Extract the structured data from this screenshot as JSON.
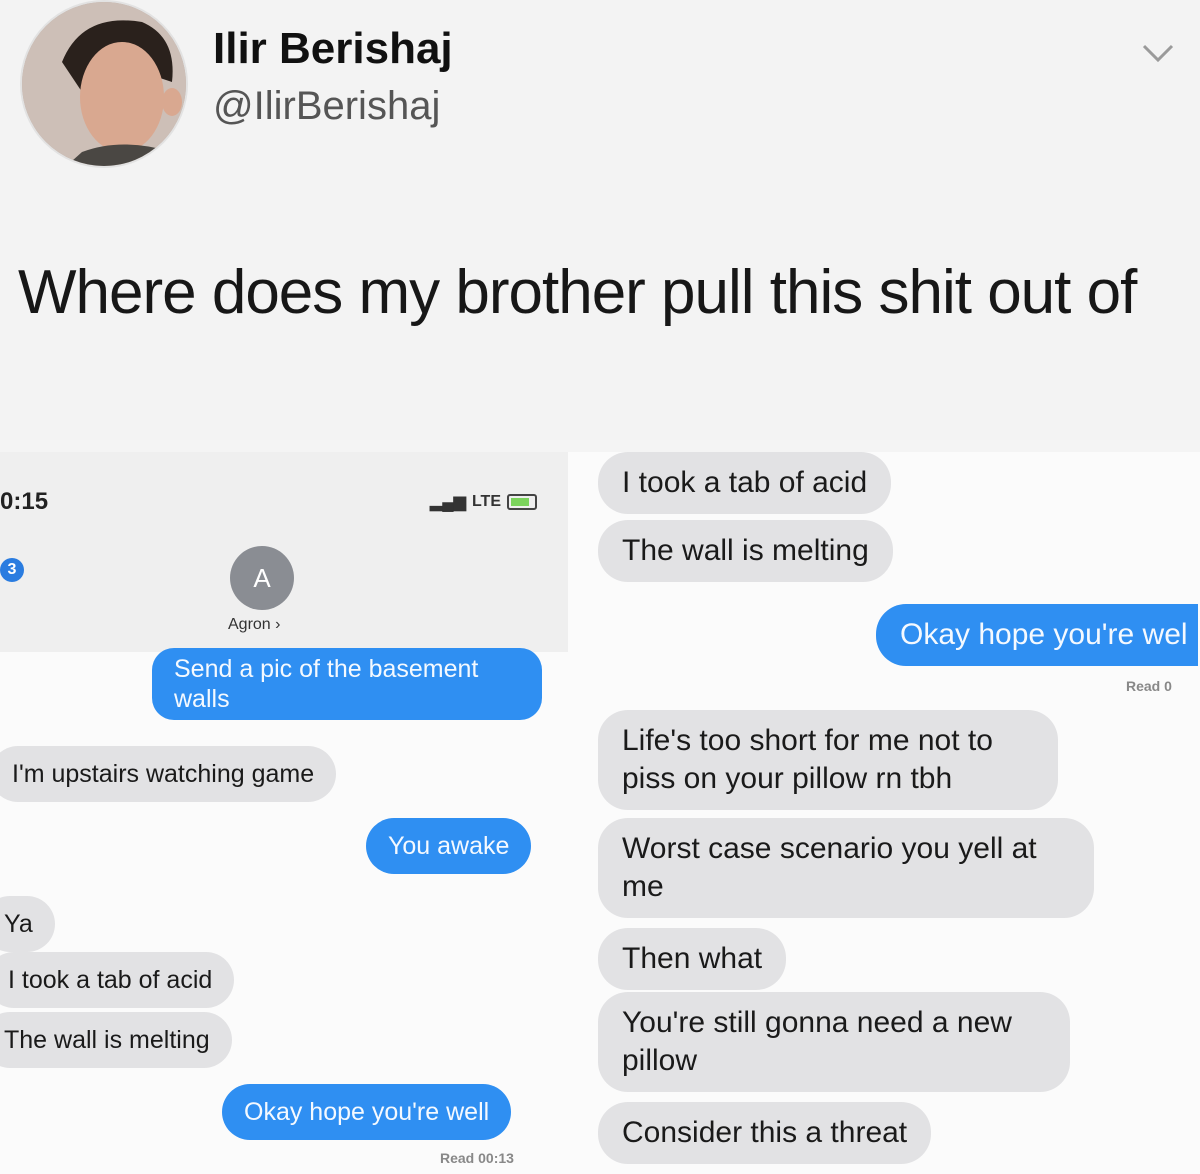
{
  "tweet": {
    "author_name": "Ilir Berishaj",
    "author_handle": "@IlirBerishaj",
    "text": "Where does my brother pull this shit out of",
    "menu_icon": "chevron-down-icon"
  },
  "screenshot": {
    "status_bar": {
      "time": "0:15",
      "network": "LTE",
      "back_badge": "3"
    },
    "contact": {
      "initial": "A",
      "name": "Agron ›"
    },
    "left_messages": [
      "Send a pic of the basement walls",
      "I'm upstairs watching game",
      "You awake",
      "Ya",
      "I took a tab of acid",
      "The wall is melting",
      "Okay hope you're well"
    ],
    "left_read": "Read 00:13",
    "right_messages": [
      "I took a tab of acid",
      "The wall is melting",
      "Okay hope you're wel",
      "Life's too short for me not to piss on your pillow rn tbh",
      "Worst case scenario you yell at me",
      "Then what",
      "You're still gonna need a new pillow",
      "Consider this a threat"
    ],
    "right_read": "Read 0"
  }
}
